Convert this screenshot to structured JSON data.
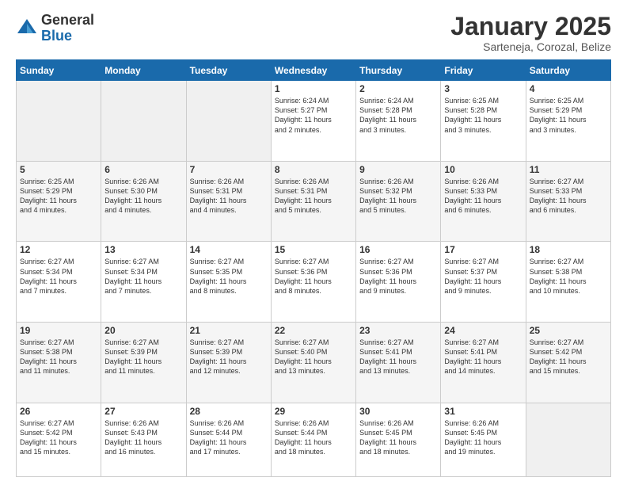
{
  "logo": {
    "general": "General",
    "blue": "Blue"
  },
  "title": "January 2025",
  "subtitle": "Sarteneja, Corozal, Belize",
  "weekdays": [
    "Sunday",
    "Monday",
    "Tuesday",
    "Wednesday",
    "Thursday",
    "Friday",
    "Saturday"
  ],
  "weeks": [
    [
      {
        "day": "",
        "info": ""
      },
      {
        "day": "",
        "info": ""
      },
      {
        "day": "",
        "info": ""
      },
      {
        "day": "1",
        "info": "Sunrise: 6:24 AM\nSunset: 5:27 PM\nDaylight: 11 hours\nand 2 minutes."
      },
      {
        "day": "2",
        "info": "Sunrise: 6:24 AM\nSunset: 5:28 PM\nDaylight: 11 hours\nand 3 minutes."
      },
      {
        "day": "3",
        "info": "Sunrise: 6:25 AM\nSunset: 5:28 PM\nDaylight: 11 hours\nand 3 minutes."
      },
      {
        "day": "4",
        "info": "Sunrise: 6:25 AM\nSunset: 5:29 PM\nDaylight: 11 hours\nand 3 minutes."
      }
    ],
    [
      {
        "day": "5",
        "info": "Sunrise: 6:25 AM\nSunset: 5:29 PM\nDaylight: 11 hours\nand 4 minutes."
      },
      {
        "day": "6",
        "info": "Sunrise: 6:26 AM\nSunset: 5:30 PM\nDaylight: 11 hours\nand 4 minutes."
      },
      {
        "day": "7",
        "info": "Sunrise: 6:26 AM\nSunset: 5:31 PM\nDaylight: 11 hours\nand 4 minutes."
      },
      {
        "day": "8",
        "info": "Sunrise: 6:26 AM\nSunset: 5:31 PM\nDaylight: 11 hours\nand 5 minutes."
      },
      {
        "day": "9",
        "info": "Sunrise: 6:26 AM\nSunset: 5:32 PM\nDaylight: 11 hours\nand 5 minutes."
      },
      {
        "day": "10",
        "info": "Sunrise: 6:26 AM\nSunset: 5:33 PM\nDaylight: 11 hours\nand 6 minutes."
      },
      {
        "day": "11",
        "info": "Sunrise: 6:27 AM\nSunset: 5:33 PM\nDaylight: 11 hours\nand 6 minutes."
      }
    ],
    [
      {
        "day": "12",
        "info": "Sunrise: 6:27 AM\nSunset: 5:34 PM\nDaylight: 11 hours\nand 7 minutes."
      },
      {
        "day": "13",
        "info": "Sunrise: 6:27 AM\nSunset: 5:34 PM\nDaylight: 11 hours\nand 7 minutes."
      },
      {
        "day": "14",
        "info": "Sunrise: 6:27 AM\nSunset: 5:35 PM\nDaylight: 11 hours\nand 8 minutes."
      },
      {
        "day": "15",
        "info": "Sunrise: 6:27 AM\nSunset: 5:36 PM\nDaylight: 11 hours\nand 8 minutes."
      },
      {
        "day": "16",
        "info": "Sunrise: 6:27 AM\nSunset: 5:36 PM\nDaylight: 11 hours\nand 9 minutes."
      },
      {
        "day": "17",
        "info": "Sunrise: 6:27 AM\nSunset: 5:37 PM\nDaylight: 11 hours\nand 9 minutes."
      },
      {
        "day": "18",
        "info": "Sunrise: 6:27 AM\nSunset: 5:38 PM\nDaylight: 11 hours\nand 10 minutes."
      }
    ],
    [
      {
        "day": "19",
        "info": "Sunrise: 6:27 AM\nSunset: 5:38 PM\nDaylight: 11 hours\nand 11 minutes."
      },
      {
        "day": "20",
        "info": "Sunrise: 6:27 AM\nSunset: 5:39 PM\nDaylight: 11 hours\nand 11 minutes."
      },
      {
        "day": "21",
        "info": "Sunrise: 6:27 AM\nSunset: 5:39 PM\nDaylight: 11 hours\nand 12 minutes."
      },
      {
        "day": "22",
        "info": "Sunrise: 6:27 AM\nSunset: 5:40 PM\nDaylight: 11 hours\nand 13 minutes."
      },
      {
        "day": "23",
        "info": "Sunrise: 6:27 AM\nSunset: 5:41 PM\nDaylight: 11 hours\nand 13 minutes."
      },
      {
        "day": "24",
        "info": "Sunrise: 6:27 AM\nSunset: 5:41 PM\nDaylight: 11 hours\nand 14 minutes."
      },
      {
        "day": "25",
        "info": "Sunrise: 6:27 AM\nSunset: 5:42 PM\nDaylight: 11 hours\nand 15 minutes."
      }
    ],
    [
      {
        "day": "26",
        "info": "Sunrise: 6:27 AM\nSunset: 5:42 PM\nDaylight: 11 hours\nand 15 minutes."
      },
      {
        "day": "27",
        "info": "Sunrise: 6:26 AM\nSunset: 5:43 PM\nDaylight: 11 hours\nand 16 minutes."
      },
      {
        "day": "28",
        "info": "Sunrise: 6:26 AM\nSunset: 5:44 PM\nDaylight: 11 hours\nand 17 minutes."
      },
      {
        "day": "29",
        "info": "Sunrise: 6:26 AM\nSunset: 5:44 PM\nDaylight: 11 hours\nand 18 minutes."
      },
      {
        "day": "30",
        "info": "Sunrise: 6:26 AM\nSunset: 5:45 PM\nDaylight: 11 hours\nand 18 minutes."
      },
      {
        "day": "31",
        "info": "Sunrise: 6:26 AM\nSunset: 5:45 PM\nDaylight: 11 hours\nand 19 minutes."
      },
      {
        "day": "",
        "info": ""
      }
    ]
  ]
}
